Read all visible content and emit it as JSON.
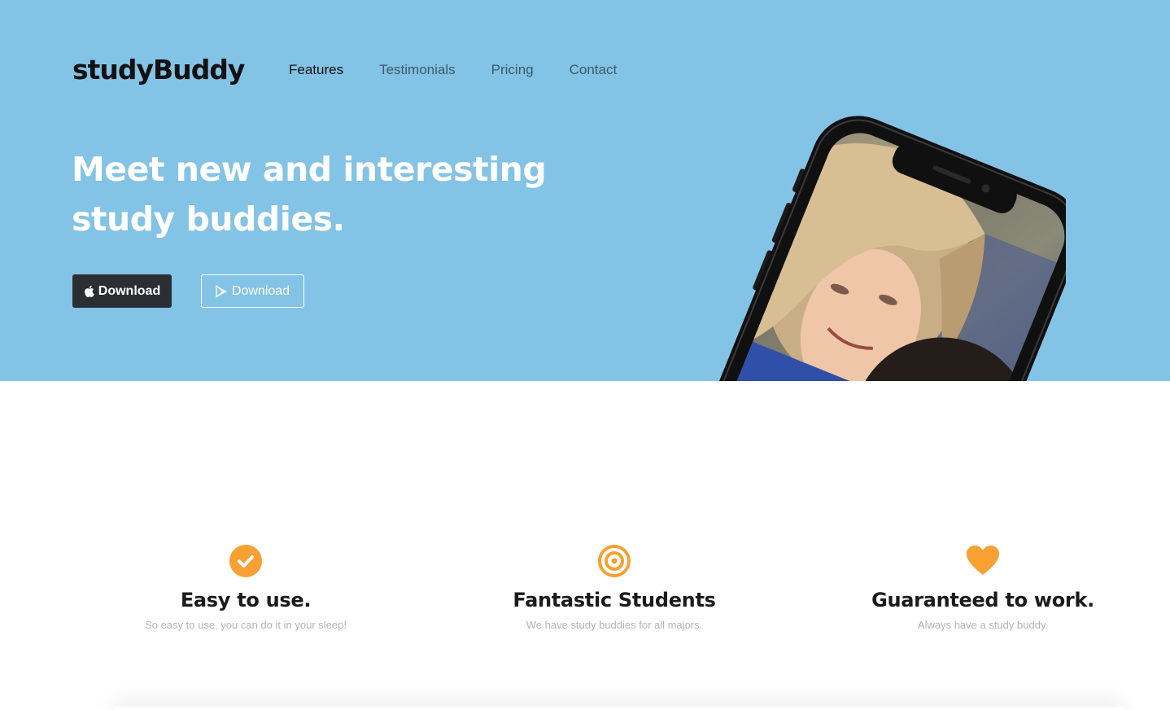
{
  "brand": {
    "logo": "studyBuddy"
  },
  "nav": {
    "items": [
      {
        "label": "Features"
      },
      {
        "label": "Testimonials"
      },
      {
        "label": "Pricing"
      },
      {
        "label": "Contact"
      }
    ]
  },
  "hero": {
    "headline": "Meet new and interesting study buddies.",
    "buttons": [
      {
        "label": "Download",
        "icon": "apple-icon"
      },
      {
        "label": "Download",
        "icon": "google-play-icon"
      }
    ]
  },
  "features": [
    {
      "icon": "checkmark-circle-icon",
      "title": "Easy to use.",
      "text": "So easy to use, you can do it in your sleep!"
    },
    {
      "icon": "target-icon",
      "title": "Fantastic Students",
      "text": "We have study buddies for all majors."
    },
    {
      "icon": "heart-icon",
      "title": "Guaranteed to work.",
      "text": "Always have a study buddy."
    }
  ],
  "colors": {
    "hero_bg": "#83c3e5",
    "accent": "#f7a033",
    "dark_button": "#2b2f33"
  }
}
